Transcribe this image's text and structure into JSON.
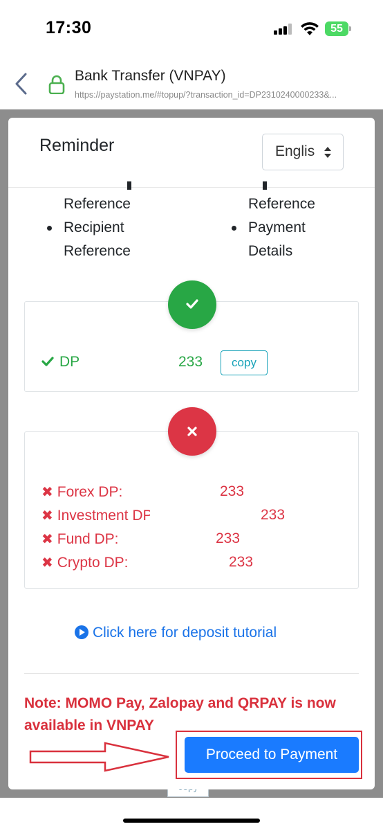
{
  "status_bar": {
    "time": "17:30",
    "battery": "55"
  },
  "browser": {
    "title": "Bank Transfer (VNPAY)",
    "url": "https://paystation.me/#topup/?transaction_id=DP2310240000233&..."
  },
  "modal": {
    "title": "Reminder",
    "language_select": "Englis",
    "left_column": {
      "line1": "Reference",
      "bullet_line1": "Recipient",
      "bullet_line2": "Reference"
    },
    "right_column": {
      "line1": "Reference",
      "bullet_line1": "Payment",
      "bullet_line2": "Details"
    },
    "correct_box": {
      "prefix": "DP",
      "suffix": "233",
      "copy_label": "copy"
    },
    "wrong_box": {
      "rows": [
        {
          "label": "Forex DP:",
          "suffix": "233"
        },
        {
          "label": "Investment DP:",
          "suffix": "233"
        },
        {
          "label": "Fund DP:",
          "suffix": "233"
        },
        {
          "label": "Crypto DP:",
          "suffix": "233"
        }
      ]
    },
    "tutorial_link": "Click here for deposit tutorial",
    "note": "Note: MOMO Pay, Zalopay and QRPAY is now available in VNPAY",
    "proceed_button": "Proceed to Payment"
  },
  "backdrop": {
    "copy_label": "copy"
  },
  "colors": {
    "success": "#28a745",
    "danger": "#dc3545",
    "primary": "#1a7bff",
    "link": "#1a73e8",
    "annotation": "#d9313d"
  },
  "icons": [
    "back-chevron-icon",
    "lock-icon",
    "sort-caret-icon",
    "check-icon",
    "close-icon",
    "play-circle-icon",
    "arrow-right-icon"
  ]
}
